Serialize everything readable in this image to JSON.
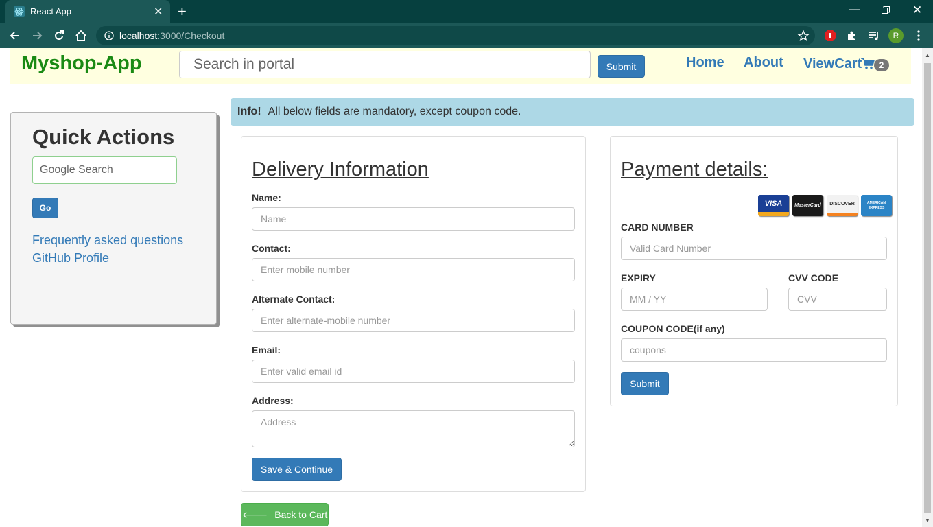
{
  "browser": {
    "tab_title": "React App",
    "url_host": "localhost",
    "url_rest": ":3000/Checkout",
    "profile_initial": "R"
  },
  "header": {
    "brand": "Myshop-App",
    "search_placeholder": "Search in portal",
    "search_button": "Submit",
    "nav": [
      "Home",
      "About",
      "ViewCart"
    ],
    "cart_count": "2"
  },
  "quick_actions": {
    "title": "Quick Actions",
    "search_placeholder": "Google Search",
    "go_button": "Go",
    "links": [
      "Frequently asked questions",
      "GitHub Profile"
    ]
  },
  "alert": {
    "strong": "Info!",
    "text": "All below fields are mandatory, except coupon code."
  },
  "delivery": {
    "title": "Delivery Information",
    "fields": [
      {
        "label": "Name:",
        "placeholder": "Name"
      },
      {
        "label": "Contact:",
        "placeholder": "Enter mobile number"
      },
      {
        "label": "Alternate Contact:",
        "placeholder": "Enter alternate-mobile number"
      },
      {
        "label": "Email:",
        "placeholder": "Enter valid email id"
      },
      {
        "label": "Address:",
        "placeholder": "Address"
      }
    ],
    "save_button": "Save & Continue"
  },
  "payment": {
    "title": "Payment details:",
    "card_logos": [
      "VISA",
      "MasterCard",
      "DISCOVER",
      "AMERICAN EXPRESS"
    ],
    "card_number_label": "CARD NUMBER",
    "card_number_placeholder": "Valid Card Number",
    "expiry_label": "EXPIRY",
    "expiry_placeholder": "MM / YY",
    "cvv_label": "CVV CODE",
    "cvv_placeholder": "CVV",
    "coupon_label": "COUPON CODE(if any)",
    "coupon_placeholder": "coupons",
    "submit_button": "Submit"
  },
  "back_button": "Back to Cart",
  "colors": {
    "brand": "#1a8a14",
    "primary": "#337ab7",
    "success": "#5cb85c",
    "header_bg": "#ffffe0",
    "alert_bg": "#add8e6"
  }
}
